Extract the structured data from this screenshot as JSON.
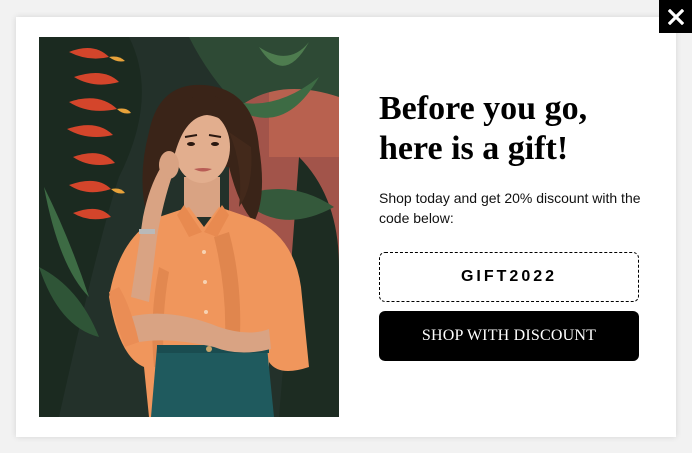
{
  "popup": {
    "headline_line1": "Before you go,",
    "headline_line2": "here is a gift!",
    "subtext": "Shop today and get 20% discount with the code below:",
    "discount_code": "GIFT2022",
    "cta_label": "SHOP WITH DISCOUNT",
    "close_icon": "close-icon"
  },
  "colors": {
    "accent": "#000000",
    "background": "#ffffff",
    "overlay": "#f2f2f2",
    "shirt": "#f0965c",
    "jeans": "#1f5a5e"
  }
}
